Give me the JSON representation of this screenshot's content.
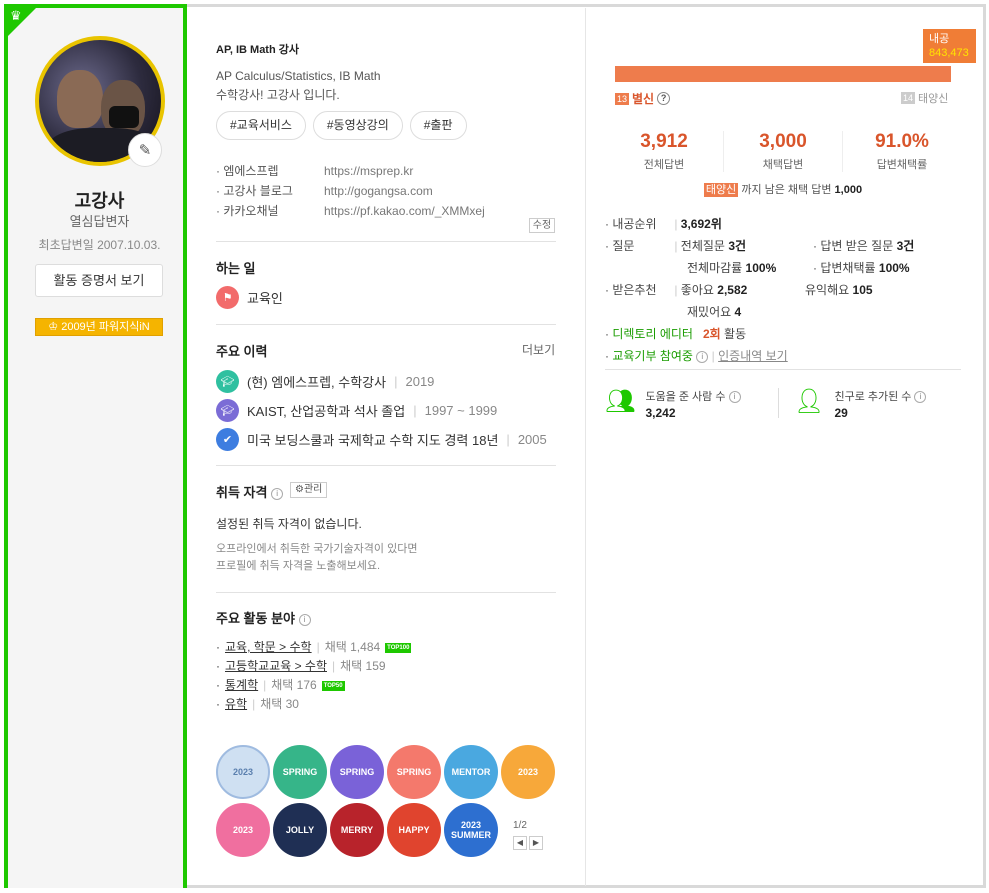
{
  "profile": {
    "nickname": "고강사",
    "grade": "열심답변자",
    "first_answer": "최초답변일 2007.10.03.",
    "cert_button": "활동 증명서 보기",
    "power_badge": "2009년 파워지식iN",
    "title": "AP, IB Math 강사",
    "intro_line1": "AP Calculus/Statistics, IB Math",
    "intro_line2": "수학강사! 고강사 입니다.",
    "tags": [
      "#교육서비스",
      "#동영상강의",
      "#출판"
    ],
    "links": [
      {
        "label": "엠에스프렙",
        "url": "https://msprep.kr"
      },
      {
        "label": "고강사 블로그",
        "url": "http://gogangsa.com"
      },
      {
        "label": "카카오채널",
        "url": "https://pf.kakao.com/_XMMxej"
      }
    ],
    "edit_label": "수정"
  },
  "work": {
    "heading": "하는 일",
    "job": "교육인"
  },
  "career": {
    "heading": "주요 이력",
    "more": "더보기",
    "items": [
      {
        "text": "(현) 엠에스프렙, 수학강사",
        "year": "2019"
      },
      {
        "text": "KAIST, 산업공학과 석사 졸업",
        "year": "1997 ~ 1999"
      },
      {
        "text": "미국 보딩스쿨과 국제학교 수학 지도 경력 18년",
        "year": "2005"
      }
    ]
  },
  "qualification": {
    "heading": "취득 자격",
    "manage": "관리",
    "none": "설정된 취득 자격이 없습니다.",
    "hint1": "오프라인에서 취득한 국가기술자격이 있다면",
    "hint2": "프로필에 취득 자격을 노출해보세요."
  },
  "fields": {
    "heading": "주요 활동 분야",
    "items": [
      {
        "name": "교육, 학문 > 수학",
        "count": "채택 1,484",
        "badge": "TOP100"
      },
      {
        "name": "고등학교교육 > 수학",
        "count": "채택 159",
        "badge": ""
      },
      {
        "name": "통계학",
        "count": "채택 176",
        "badge": "TOP50"
      },
      {
        "name": "유학",
        "count": "채택 30",
        "badge": ""
      }
    ]
  },
  "badges": {
    "items": [
      "2023",
      "SPRING",
      "SPRING",
      "SPRING",
      "MENTOR",
      "2023",
      "2023",
      "JOLLY",
      "MERRY",
      "HAPPY",
      "2023 SUMMER"
    ],
    "page": "1/2",
    "prev": "◀",
    "next": "▶"
  },
  "rank": {
    "label": "내공",
    "value": "843,473",
    "current_num": "13",
    "current_name": "별신",
    "next_num": "14",
    "next_name": "태양신",
    "progress_fraction": 1.0
  },
  "stats": [
    {
      "value": "3,912",
      "label": "전체답변"
    },
    {
      "value": "3,000",
      "label": "채택답변"
    },
    {
      "value": "91.0%",
      "label": "답변채택률"
    }
  ],
  "remain": {
    "target": "태양신",
    "text": "까지 남은 채택 답변",
    "value": "1,000"
  },
  "details": {
    "rank_label": "내공순위",
    "rank_value": "3,692위",
    "q_label": "질문",
    "q_total": "전체질문",
    "q_total_v": "3건",
    "q_recv": "답변 받은 질문",
    "q_recv_v": "3건",
    "q_close": "전체마감률",
    "q_close_v": "100%",
    "q_adopt": "답변채택률",
    "q_adopt_v": "100%",
    "rec_label": "받은추천",
    "rec_good": "좋아요",
    "rec_good_v": "2,582",
    "rec_useful": "유익해요",
    "rec_useful_v": "105",
    "rec_fun": "재밌어요",
    "rec_fun_v": "4",
    "dir_label": "디렉토리 에디터",
    "dir_count": "2회",
    "dir_suffix": "활동",
    "donate_label": "교육기부 참여중",
    "donate_link": "인증내역 보기"
  },
  "social": {
    "helped_label": "도움을 준 사람 수",
    "helped_value": "3,242",
    "friends_label": "친구로 추가된 수",
    "friends_value": "29"
  },
  "colors": {
    "green": "#1ec800",
    "orange": "#ee7c4c",
    "red_num": "#d9552b"
  }
}
